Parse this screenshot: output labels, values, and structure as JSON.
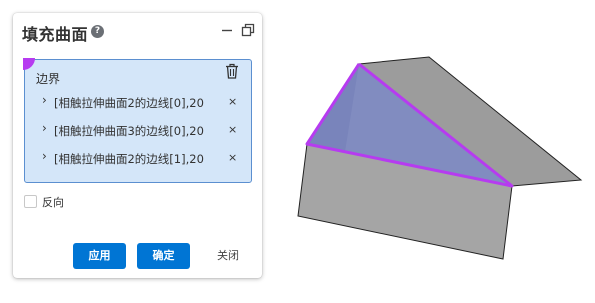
{
  "panel": {
    "title": "填充曲面",
    "help_glyph": "?",
    "boundary": {
      "label": "边界",
      "edges": [
        {
          "label": "[相触拉伸曲面2的边线[0],20",
          "remove_glyph": "×"
        },
        {
          "label": "[相触拉伸曲面3的边线[0],20",
          "remove_glyph": "×"
        },
        {
          "label": "[相触拉伸曲面2的边线[1],20",
          "remove_glyph": "×"
        }
      ]
    },
    "reverse_label": "反向",
    "buttons": {
      "apply": "应用",
      "ok": "确定",
      "close": "关闭"
    }
  },
  "colors": {
    "accent": "#0075d4",
    "selection_fill": "#d4e6f9",
    "selection_border": "#5b8fd0",
    "highlight_edge": "#b63bf0",
    "fill_surface": "#7a86bd",
    "model_gray": "#a5a5a5"
  },
  "icons": [
    "help-icon",
    "minimize-icon",
    "restore-icon",
    "trash-icon",
    "chevron-right-icon",
    "close-icon"
  ]
}
